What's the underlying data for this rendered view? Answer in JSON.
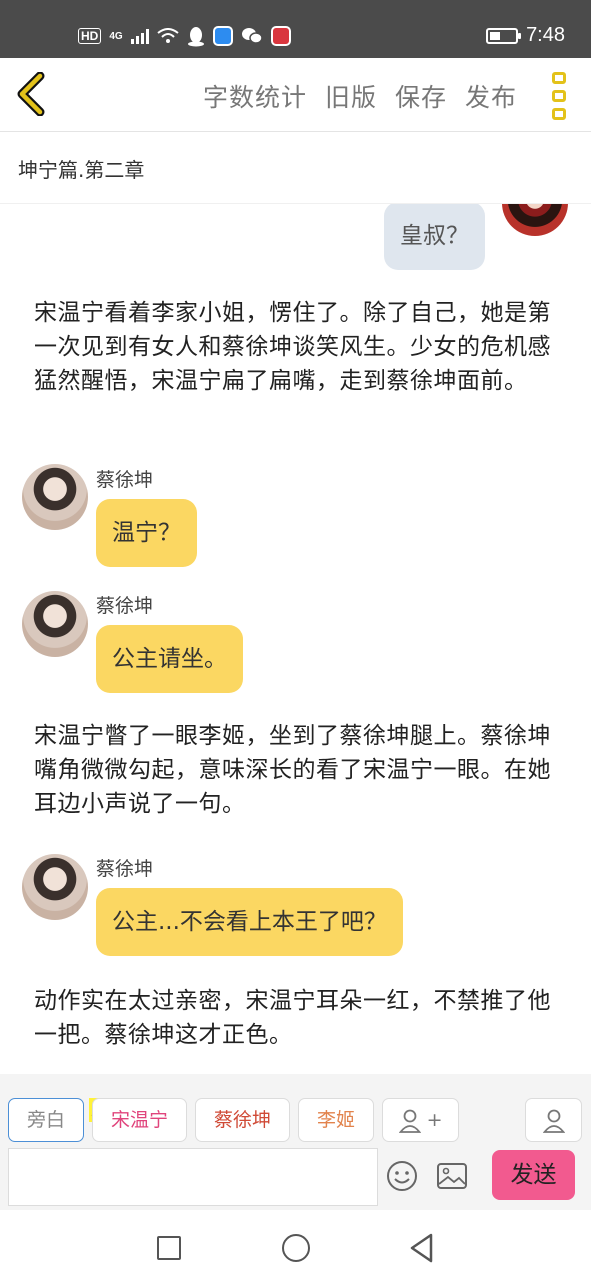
{
  "status_bar": {
    "hd": "HD",
    "network": "4G",
    "time": "7:48"
  },
  "toolbar": {
    "actions": [
      "字数统计",
      "旧版",
      "保存",
      "发布"
    ]
  },
  "chapter": {
    "title": "坤宁篇.第二章"
  },
  "messages": {
    "top_bubble": "皇叔？",
    "narration_1": "宋温宁看着李家小姐，愣住了。除了自己，她是第一次见到有女人和蔡徐坤谈笑风生。少女的危机感猛然醒悟，宋温宁扁了扁嘴，走到蔡徐坤面前。",
    "msg_1": {
      "speaker": "蔡徐坤",
      "text": "温宁？"
    },
    "msg_2": {
      "speaker": "蔡徐坤",
      "text": "公主请坐。"
    },
    "narration_2": "宋温宁瞥了一眼李姬，坐到了蔡徐坤腿上。蔡徐坤嘴角微微勾起，意味深长的看了宋温宁一眼。在她耳边小声说了一句。",
    "msg_3": {
      "speaker": "蔡徐坤",
      "text": "公主...不会看上本王了吧？"
    },
    "narration_3": "动作实在太过亲密，宋温宁耳朵一红，不禁推了他一把。蔡徐坤这才正色。"
  },
  "panel": {
    "chips": [
      {
        "label": "旁白",
        "color": "#888888"
      },
      {
        "label": "宋温宁",
        "color": "#e0447c"
      },
      {
        "label": "蔡徐坤",
        "color": "#d04a36"
      },
      {
        "label": "李姬",
        "color": "#e2834c"
      }
    ],
    "main_badge": "主",
    "add_role": "+",
    "send": "发送"
  },
  "colors": {
    "accent_yellow": "#e3c21a",
    "bubble_yellow": "#fbd762",
    "send_pink": "#f25a8f"
  }
}
